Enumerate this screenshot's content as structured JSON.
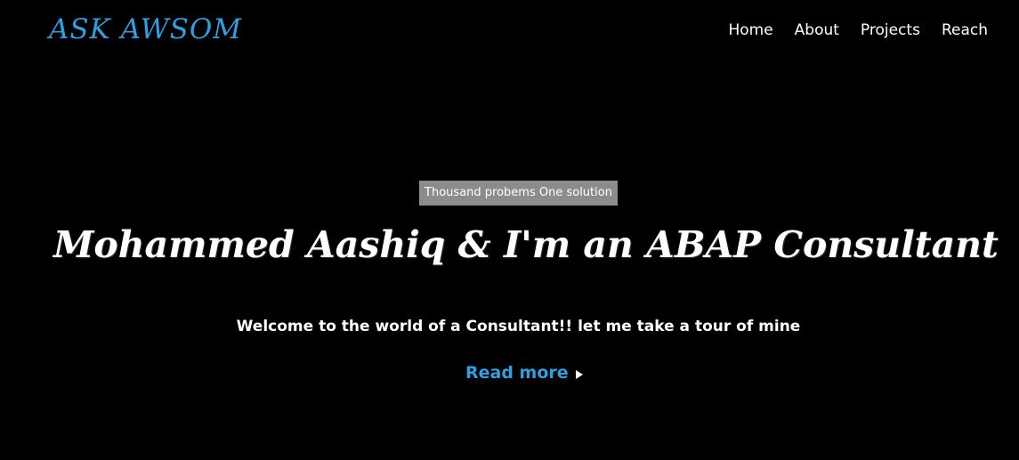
{
  "header": {
    "brand": "ASK AWSOM",
    "nav": [
      {
        "label": "Home"
      },
      {
        "label": "About"
      },
      {
        "label": "Projects"
      },
      {
        "label": "Reach"
      }
    ]
  },
  "hero": {
    "tagline": "Thousand probems One solution",
    "headline": "Mohammed Aashiq & I'm an ABAP Consultant",
    "welcome": "Welcome to the world of a Consultant!! let me take a tour of mine",
    "read_more": "Read more",
    "read_more_icon": "play-icon"
  },
  "colors": {
    "background": "#000000",
    "accent": "#2f9fe0",
    "tagline_bg": "#8c8c8c",
    "text": "#ffffff"
  }
}
